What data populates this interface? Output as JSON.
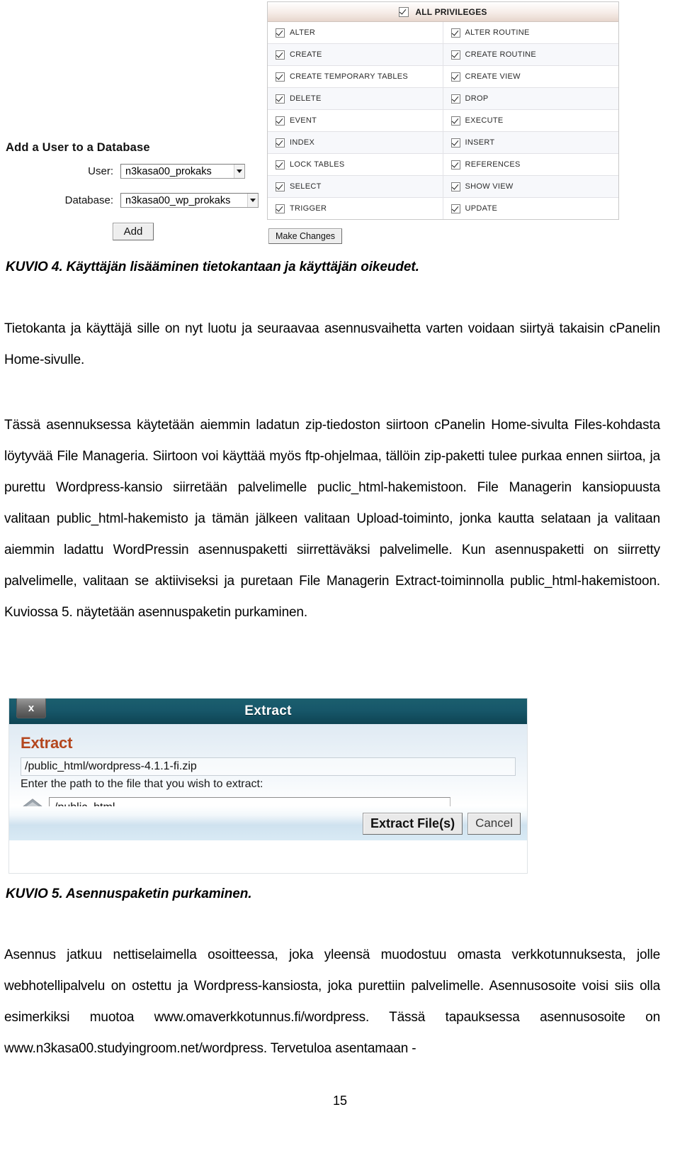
{
  "figure4": {
    "privileges_panel": {
      "header_label": "ALL PRIVILEGES",
      "rows": [
        {
          "left": "ALTER",
          "right": "ALTER ROUTINE"
        },
        {
          "left": "CREATE",
          "right": "CREATE ROUTINE"
        },
        {
          "left": "CREATE TEMPORARY TABLES",
          "right": "CREATE VIEW"
        },
        {
          "left": "DELETE",
          "right": "DROP"
        },
        {
          "left": "EVENT",
          "right": "EXECUTE"
        },
        {
          "left": "INDEX",
          "right": "INSERT"
        },
        {
          "left": "LOCK TABLES",
          "right": "REFERENCES"
        },
        {
          "left": "SELECT",
          "right": "SHOW VIEW"
        },
        {
          "left": "TRIGGER",
          "right": "UPDATE"
        }
      ],
      "make_changes_label": "Make Changes"
    },
    "add_user_form": {
      "title": "Add a User to a Database",
      "user_label": "User:",
      "user_value": "n3kasa00_prokaks",
      "database_label": "Database:",
      "database_value": "n3kasa00_wp_prokaks",
      "add_label": "Add"
    }
  },
  "captions": {
    "kuvio4": "KUVIO 4. Käyttäjän lisääminen tietokantaan ja käyttäjän oikeudet.",
    "kuvio5": "KUVIO 5. Asennuspaketin purkaminen."
  },
  "body": {
    "para1": "Tietokanta ja käyttäjä sille on nyt luotu ja seuraavaa asennusvaihetta varten voidaan siirtyä takaisin cPanelin Home-sivulle.",
    "para2": "Tässä asennuksessa käytetään aiemmin ladatun zip-tiedoston siirtoon cPanelin Home-sivulta Files-kohdasta löytyvää File Manageria. Siirtoon voi käyttää myös ftp-ohjelmaa, tällöin zip-paketti tulee purkaa ennen siirtoa, ja purettu Wordpress-kansio siirretään palvelimelle puclic_html-hakemistoon. File Managerin kansiopuusta valitaan public_html-hakemisto ja tämän jälkeen valitaan Upload-toiminto, jonka kautta selataan ja valitaan aiemmin ladattu WordPressin asennuspaketti siirrettäväksi palvelimelle. Kun asennuspaketti on siirretty palvelimelle, valitaan se aktiiviseksi ja puretaan File Managerin Extract-toiminnolla public_html-hakemistoon. Kuviossa 5. näytetään asennuspaketin purkaminen.",
    "para3": "Asennus jatkuu nettiselaimella osoitteessa, joka yleensä muodostuu omasta verkkotunnuksesta, jolle webhotellipalvelu on ostettu ja Wordpress-kansiosta, joka purettiin palvelimelle. Asennusosoite voisi siis olla esimerkiksi muotoa www.omaverkkotunnus.fi/wordpress. Tässä tapauksessa asennusosoite on www.n3kasa00.studyingroom.net/wordpress. Tervetuloa asentamaan -"
  },
  "figure5": {
    "window_title": "Extract",
    "close_label": "x",
    "heading": "Extract",
    "source_path": "/public_html/wordpress-4.1.1-fi.zip",
    "hint": "Enter the path to the file that you wish to extract:",
    "destination_value": "/public_html",
    "extract_button": "Extract File(s)",
    "cancel_button": "Cancel"
  },
  "page_number": "15",
  "colors": {
    "dialog_titlebar": "#15566a",
    "dialog_heading": "#b4471f",
    "privileges_header": "#e7d6cd"
  }
}
